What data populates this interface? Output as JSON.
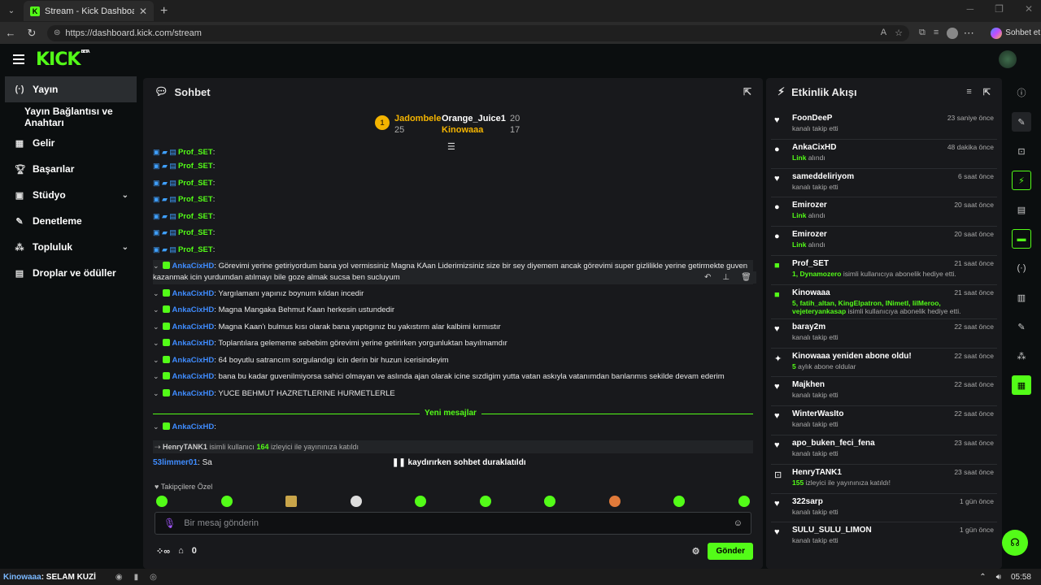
{
  "browser": {
    "tab_title": "Stream - Kick Dashboard",
    "url": "https://dashboard.kick.com/stream",
    "copilot_label": "Sohbet et"
  },
  "header": {
    "logo": "KICK",
    "beta": "BETA"
  },
  "sidebar": {
    "items": [
      {
        "label": "Yayın",
        "icon": "broadcast-icon"
      },
      {
        "label": "Yayın Bağlantısı ve Anahtarı",
        "icon": ""
      },
      {
        "label": "Gelir",
        "icon": "chart-icon"
      },
      {
        "label": "Başarılar",
        "icon": "trophy-icon"
      },
      {
        "label": "Stüdyo",
        "icon": "studio-icon"
      },
      {
        "label": "Denetleme",
        "icon": "wrench-icon"
      },
      {
        "label": "Topluluk",
        "icon": "community-icon"
      },
      {
        "label": "Droplar ve ödüller",
        "icon": "gift-icon"
      }
    ]
  },
  "chat": {
    "title": "Sohbet",
    "leaderboard": {
      "first_name": "Jadombele",
      "first_count": "25",
      "second_name": "Orange_Juice1",
      "second_count": "20",
      "third_name": "Kinowaaa",
      "third_count": "17",
      "medal": "1"
    },
    "messages": [
      {
        "user": "Prof_SET",
        "text": ":"
      },
      {
        "user": "Prof_SET",
        "text": ":"
      },
      {
        "user": "Prof_SET",
        "text": ":"
      },
      {
        "user": "Prof_SET",
        "text": ":"
      },
      {
        "user": "Prof_SET",
        "text": ":"
      },
      {
        "user": "Prof_SET",
        "text": ":"
      },
      {
        "user": "Prof_SET",
        "text": ":"
      },
      {
        "user": "AnkaCixHD",
        "text": ": Görevimi yerine getiriyordum bana yol vermissiniz Magna KAan Liderimizsiniz size bir sey diyemem ancak görevimi super gizlilikle yerine getirmekte guven kazanmak icin yurdumdan atılmayı bile goze almak sucsa ben sucluyum"
      },
      {
        "user": "AnkaCixHD",
        "text": ": Yargılamanı yapınız boynum kıldan incedir"
      },
      {
        "user": "AnkaCixHD",
        "text": ": Magna Mangaka Behmut Kaan herkesin ustundedir"
      },
      {
        "user": "AnkaCixHD",
        "text": ": Magna Kaan'ı bulmus kısı olarak bana yaptıgınız bu yakıstırm alar kalbimi kırmıstır"
      },
      {
        "user": "AnkaCixHD",
        "text": ": Toplantılara gelememe sebebim görevimi yerine getirirken yorgunluktan bayılmamdır"
      },
      {
        "user": "AnkaCixHD",
        "text": ": 64 boyutlu satrancım sorgulandıgı icin derin bir huzun icerisindeyim"
      },
      {
        "user": "AnkaCixHD",
        "text": ": bana bu kadar guvenilmiyorsa sahici olmayan ve aslında ajan olarak icine sızdigim yutta vatan askıyla vatanımdan banlanmıs sekilde devam ederim"
      },
      {
        "user": "AnkaCixHD",
        "text": ": YUCE BEHMUT HAZRETLERINE HURMETLERLE"
      },
      {
        "user": "AnkaCixHD",
        "text": ":"
      }
    ],
    "new_messages_label": "Yeni mesajlar",
    "host_notice": {
      "name": "HenryTANK1",
      "pre": "isimli kullanıcı",
      "viewers": "164",
      "post": "izleyici ile yayınınıza katıldı"
    },
    "last_user": "53limmer01",
    "last_text": ": Sa",
    "paused_text": "kaydırırken sohbet duraklatıldı",
    "emote_title": "Takipçilere Özel",
    "input_placeholder": "Bir mesaj gönderin",
    "points_count": "0",
    "send_label": "Gönder"
  },
  "activity": {
    "title": "Etkinlik Akışı",
    "items": [
      {
        "icon": "heart-icon",
        "user": "FoonDeeP",
        "time": "23 saniye önce",
        "hl": "",
        "desc": "kanalı takip etti"
      },
      {
        "icon": "link-icon",
        "user": "AnkaCixHD",
        "time": "48 dakika önce",
        "hl": "Link",
        "desc": "alındı"
      },
      {
        "icon": "heart-icon",
        "user": "sameddeliriyom",
        "time": "6 saat önce",
        "hl": "",
        "desc": "kanalı takip etti"
      },
      {
        "icon": "link-icon",
        "user": "Emirozer",
        "time": "20 saat önce",
        "hl": "Link",
        "desc": "alındı"
      },
      {
        "icon": "link-icon",
        "user": "Emirozer",
        "time": "20 saat önce",
        "hl": "Link",
        "desc": "alındı"
      },
      {
        "icon": "gift-icon",
        "user": "Prof_SET",
        "time": "21 saat önce",
        "hl": "1, Dynamozero",
        "desc": "isimli kullanıcıya abonelik hediye etti."
      },
      {
        "icon": "gift-icon",
        "user": "Kinowaaa",
        "time": "21 saat önce",
        "hl": "5, fatih_altan, KingElpatron, INimetI, lilMeroo, vejeteryankasap",
        "desc": "isimli kullanıcıya abonelik hediye etti."
      },
      {
        "icon": "heart-icon",
        "user": "baray2m",
        "time": "22 saat önce",
        "hl": "",
        "desc": "kanalı takip etti"
      },
      {
        "icon": "star-icon",
        "user": "Kinowaaa yeniden abone oldu!",
        "time": "22 saat önce",
        "hl": "5",
        "desc": "aylık abone oldular"
      },
      {
        "icon": "heart-icon",
        "user": "Majkhen",
        "time": "22 saat önce",
        "hl": "",
        "desc": "kanalı takip etti"
      },
      {
        "icon": "heart-icon",
        "user": "WinterWasIto",
        "time": "22 saat önce",
        "hl": "",
        "desc": "kanalı takip etti"
      },
      {
        "icon": "heart-icon",
        "user": "apo_buken_feci_fena",
        "time": "23 saat önce",
        "hl": "",
        "desc": "kanalı takip etti"
      },
      {
        "icon": "host-icon",
        "user": "HenryTANK1",
        "time": "23 saat önce",
        "hl": "155",
        "desc": "izleyici ile yayınınıza katıldı!"
      },
      {
        "icon": "heart-icon",
        "user": "322sarp",
        "time": "1 gün önce",
        "hl": "",
        "desc": "kanalı takip etti"
      },
      {
        "icon": "heart-icon",
        "user": "SULU_SULU_LIMON",
        "time": "1 gün önce",
        "hl": "",
        "desc": "kanalı takip etti"
      }
    ]
  },
  "taskbar": {
    "media_user": "Kinowaaa",
    "media_text": ": SELAM KUZİ",
    "time": "05:58"
  },
  "colors": {
    "accent": "#53fc18",
    "panel": "#18191c",
    "background": "#0b0e0f",
    "link_user": "#3f8cff"
  }
}
